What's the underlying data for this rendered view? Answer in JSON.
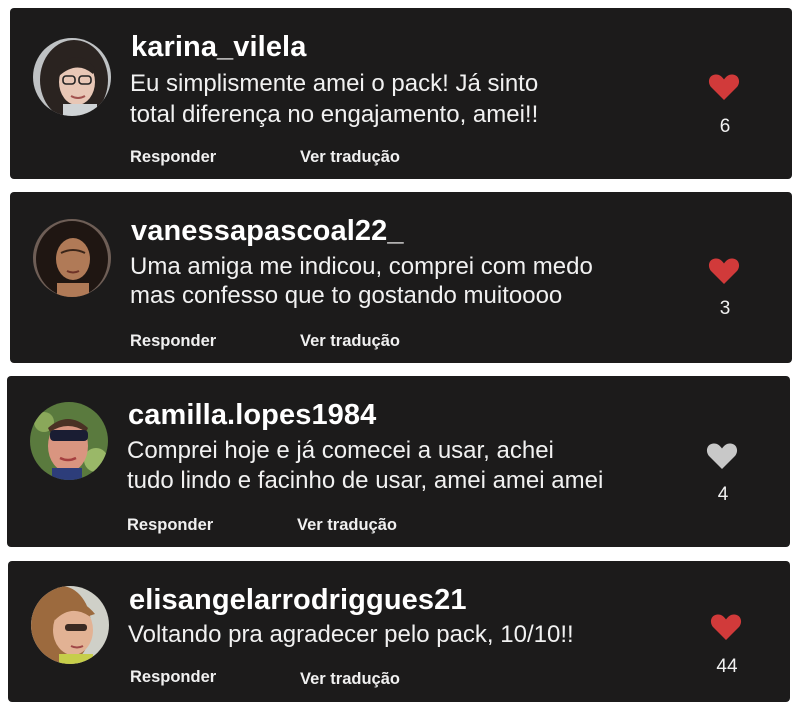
{
  "colors": {
    "card_background": "#1c1b1b",
    "heart_liked": "#d13a3a",
    "heart_unliked": "#c8c8c8"
  },
  "comments": [
    {
      "username": "karina_vilela",
      "text_lines": [
        "Eu simplismente amei o pack! Já sinto",
        "total diferença no engajamento, amei!!"
      ],
      "reply_label": "Responder",
      "translate_label": "Ver tradução",
      "likes": "6",
      "liked": true,
      "heart_icon": "heart-icon"
    },
    {
      "username": "vanessapascoal22_",
      "text_lines": [
        "Uma amiga me indicou, comprei com medo",
        "mas confesso que to gostando muitoooo"
      ],
      "reply_label": "Responder",
      "translate_label": "Ver tradução",
      "likes": "3",
      "liked": true,
      "heart_icon": "heart-icon"
    },
    {
      "username": "camilla.lopes1984",
      "text_lines": [
        "Comprei hoje e já comecei a usar, achei",
        "tudo lindo e facinho de usar, amei amei amei"
      ],
      "reply_label": "Responder",
      "translate_label": "Ver tradução",
      "likes": "4",
      "liked": false,
      "heart_icon": "heart-icon"
    },
    {
      "username": "elisangelarrodriggues21",
      "text_lines": [
        "Voltando pra agradecer pelo pack, 10/10!!"
      ],
      "reply_label": "Responder",
      "translate_label": "Ver tradução",
      "likes": "44",
      "liked": true,
      "heart_icon": "heart-icon"
    }
  ]
}
